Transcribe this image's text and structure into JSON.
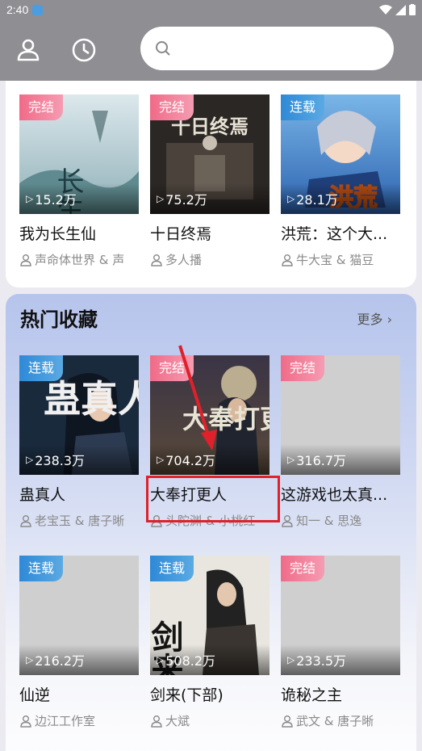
{
  "status_bar": {
    "time": "2:40"
  },
  "search": {
    "placeholder": ""
  },
  "top_books": [
    {
      "badge": "完结",
      "badge_type": "done",
      "plays": "15.2万",
      "title": "我为长生仙",
      "authors": "声命体世界 & 声"
    },
    {
      "badge": "完结",
      "badge_type": "done",
      "plays": "75.2万",
      "title": "十日终焉",
      "authors": "多人播"
    },
    {
      "badge": "连载",
      "badge_type": "serial",
      "plays": "28.1万",
      "title": "洪荒：这个大...",
      "authors": "牛大宝 & 猫豆"
    }
  ],
  "hot_section": {
    "title": "热门收藏",
    "more_label": "更多",
    "books": [
      {
        "badge": "连载",
        "badge_type": "serial",
        "plays": "238.3万",
        "title": "蛊真人",
        "authors": "老宝玉 & 唐子晰"
      },
      {
        "badge": "完结",
        "badge_type": "done",
        "plays": "704.2万",
        "title": "大奉打更人",
        "authors": "头陀渊 & 小桃红"
      },
      {
        "badge": "完结",
        "badge_type": "done",
        "plays": "316.7万",
        "title": "这游戏也太真...",
        "authors": "知一 & 思逸"
      },
      {
        "badge": "连载",
        "badge_type": "serial",
        "plays": "216.2万",
        "title": "仙逆",
        "authors": "边江工作室"
      },
      {
        "badge": "连载",
        "badge_type": "serial",
        "plays": "508.2万",
        "title": "剑来(下部)",
        "authors": "大斌"
      },
      {
        "badge": "完结",
        "badge_type": "done",
        "plays": "233.5万",
        "title": "诡秘之主",
        "authors": "武文 & 唐子晰"
      }
    ]
  },
  "cover_lettering": {
    "cover_1": "长生仙",
    "cover_2": "十日终焉",
    "cover_3": "洪荒",
    "cover_4": "蛊真人",
    "cover_5": "大奉打更人",
    "cover_6": "剑来"
  },
  "colors": {
    "badge_done": "#f06b88",
    "badge_serial": "#2f89d6",
    "highlight": "#e0202a",
    "header_bg": "#8e8e93"
  }
}
